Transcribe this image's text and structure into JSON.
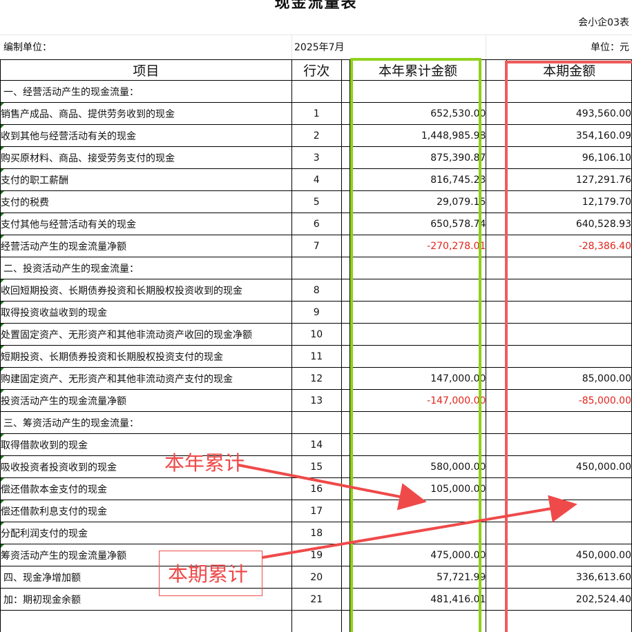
{
  "report": {
    "title": "现金流量表",
    "form_code": "会小企03表",
    "unit_label": "编制单位：",
    "period": "2025年7月",
    "currency_label": "单位：元"
  },
  "columns": {
    "item": "项目",
    "line": "行次",
    "ytd": "本年累计金额",
    "current": "本期金额"
  },
  "rows": [
    {
      "item": "一、经营活动产生的现金流量：",
      "line": "",
      "ytd": "",
      "current": "",
      "section": true
    },
    {
      "item": "销售产成品、商品、提供劳务收到的现金",
      "line": "1",
      "ytd": "652,530.00",
      "current": "493,560.00"
    },
    {
      "item": "收到其他与经营活动有关的现金",
      "line": "2",
      "ytd": "1,448,985.98",
      "current": "354,160.09"
    },
    {
      "item": "购买原材料、商品、接受劳务支付的现金",
      "line": "3",
      "ytd": "875,390.87",
      "current": "96,106.10"
    },
    {
      "item": "支付的职工薪酬",
      "line": "4",
      "ytd": "816,745.23",
      "current": "127,291.76"
    },
    {
      "item": "支付的税费",
      "line": "5",
      "ytd": "29,079.15",
      "current": "12,179.70"
    },
    {
      "item": "支付其他与经营活动有关的现金",
      "line": "6",
      "ytd": "650,578.74",
      "current": "640,528.93"
    },
    {
      "item": "经营活动产生的现金流量净额",
      "line": "7",
      "ytd": "-270,278.01",
      "current": "-28,386.40",
      "neg": true
    },
    {
      "item": "二、投资活动产生的现金流量：",
      "line": "",
      "ytd": "",
      "current": "",
      "section": true
    },
    {
      "item": "收回短期投资、长期债券投资和长期股权投资收到的现金",
      "line": "8",
      "ytd": "",
      "current": ""
    },
    {
      "item": "取得投资收益收到的现金",
      "line": "9",
      "ytd": "",
      "current": ""
    },
    {
      "item": "处置固定资产、无形资产和其他非流动资产收回的现金净额",
      "line": "10",
      "ytd": "",
      "current": ""
    },
    {
      "item": "短期投资、长期债券投资和长期股权投资支付的现金",
      "line": "11",
      "ytd": "",
      "current": ""
    },
    {
      "item": "购建固定资产、无形资产和其他非流动资产支付的现金",
      "line": "12",
      "ytd": "147,000.00",
      "current": "85,000.00"
    },
    {
      "item": "投资活动产生的现金流量净额",
      "line": "13",
      "ytd": "-147,000.00",
      "current": "-85,000.00",
      "neg": true
    },
    {
      "item": "三、筹资活动产生的现金流量：",
      "line": "",
      "ytd": "",
      "current": "",
      "section": true
    },
    {
      "item": "取得借款收到的现金",
      "line": "14",
      "ytd": "",
      "current": ""
    },
    {
      "item": "吸收投资者投资收到的现金",
      "line": "15",
      "ytd": "580,000.00",
      "current": "450,000.00"
    },
    {
      "item": "偿还借款本金支付的现金",
      "line": "16",
      "ytd": "105,000.00",
      "current": ""
    },
    {
      "item": "偿还借款利息支付的现金",
      "line": "17",
      "ytd": "",
      "current": ""
    },
    {
      "item": "分配利润支付的现金",
      "line": "18",
      "ytd": "",
      "current": ""
    },
    {
      "item": "筹资活动产生的现金流量净额",
      "line": "19",
      "ytd": "475,000.00",
      "current": "450,000.00"
    },
    {
      "item": "四、现金净增加额",
      "line": "20",
      "ytd": "57,721.99",
      "current": "336,613.60",
      "section": true
    },
    {
      "item": "加：期初现金余额",
      "line": "21",
      "ytd": "481,416.01",
      "current": "202,524.40",
      "section": true
    },
    {
      "item": "",
      "line": "",
      "ytd": "",
      "current": "",
      "section": true
    }
  ],
  "annotations": {
    "ytd_note": "本年累计",
    "current_note": "本期累计",
    "ytd_box_color": "#8fd11a",
    "current_box_color": "#ef5b5b",
    "note_color": "#ef4a4a"
  }
}
